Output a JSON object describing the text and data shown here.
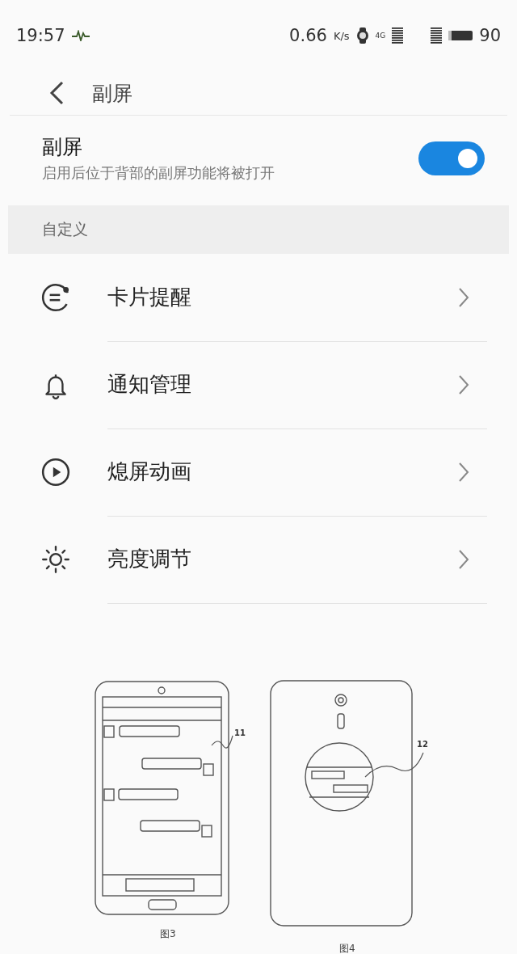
{
  "status_bar": {
    "time": "19:57",
    "speed": "0.66",
    "speed_unit": "K/s",
    "network": "4G",
    "battery": "90"
  },
  "header": {
    "title": "副屏"
  },
  "toggle": {
    "title": "副屏",
    "description": "启用后位于背部的副屏功能将被打开",
    "on": true
  },
  "section": {
    "title": "自定义"
  },
  "items": [
    {
      "label": "卡片提醒",
      "kind": "card"
    },
    {
      "label": "通知管理",
      "kind": "bell"
    },
    {
      "label": "熄屏动画",
      "kind": "play"
    },
    {
      "label": "亮度调节",
      "kind": "sun"
    }
  ],
  "figures": [
    {
      "kind": "front",
      "caption": "图3",
      "ref": "11"
    },
    {
      "kind": "back",
      "caption": "图4",
      "ref": "12"
    }
  ]
}
